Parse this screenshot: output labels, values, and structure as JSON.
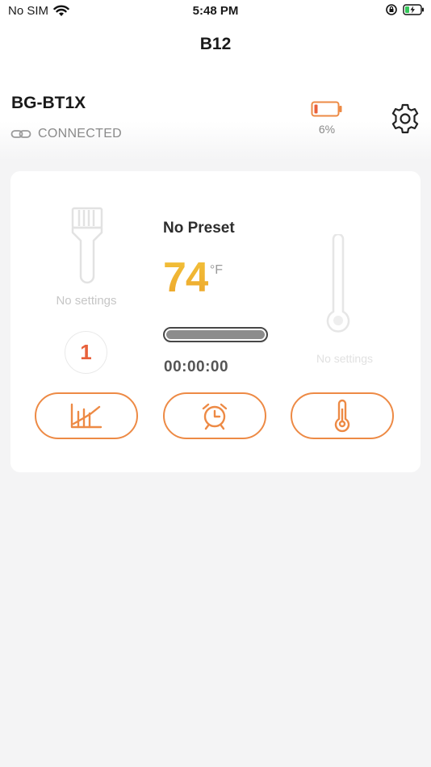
{
  "status_bar": {
    "carrier": "No SIM",
    "time": "5:48 PM",
    "wifi_icon": "wifi-icon",
    "battery_icon": "battery-charging-icon"
  },
  "nav": {
    "title": "B12"
  },
  "device": {
    "name": "BG-BT1X",
    "connection_status": "CONNECTED",
    "battery_percent_label": "6%",
    "battery_level": 0.06
  },
  "left_panel": {
    "settings_label": "No settings",
    "counter": "1"
  },
  "center_panel": {
    "preset": "No Preset",
    "temperature": "74",
    "unit": "°F",
    "progress": 1.0,
    "timer": "00:00:00"
  },
  "right_panel": {
    "settings_label": "No settings"
  },
  "buttons": [
    {
      "icon": "chart-icon"
    },
    {
      "icon": "alarm-clock-icon"
    },
    {
      "icon": "thermometer-icon"
    }
  ],
  "colors": {
    "accent": "#ed8a45",
    "temperature": "#f2c33b",
    "counter": "#e8613b",
    "battery_low": "#ed8a45"
  }
}
